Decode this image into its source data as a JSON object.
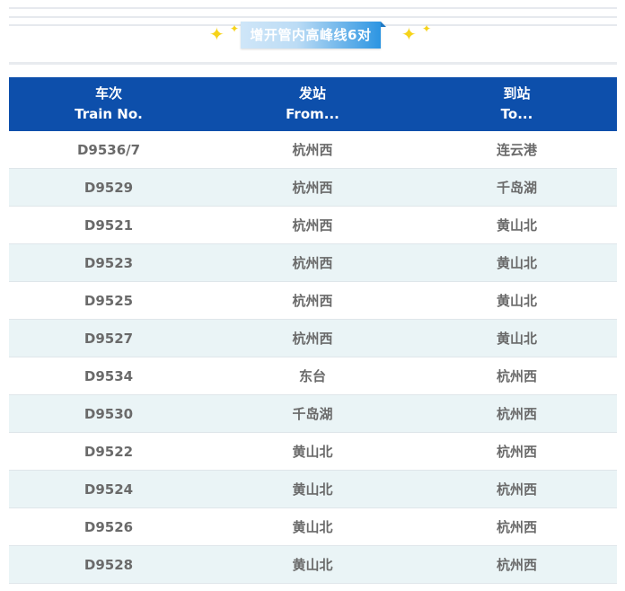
{
  "banner": {
    "title": "增开管内高峰线6对",
    "sparkle_color": "#f6d31a",
    "accent_color": "#2c95e2"
  },
  "table": {
    "header_color": "#0d4fab",
    "stripe_color": "#eaf4f6",
    "headers": [
      {
        "cn": "车次",
        "en": "Train No."
      },
      {
        "cn": "发站",
        "en": "From..."
      },
      {
        "cn": "到站",
        "en": "To..."
      }
    ],
    "rows": [
      {
        "train": "D9536/7",
        "from": "杭州西",
        "to": "连云港"
      },
      {
        "train": "D9529",
        "from": "杭州西",
        "to": "千岛湖"
      },
      {
        "train": "D9521",
        "from": "杭州西",
        "to": "黄山北"
      },
      {
        "train": "D9523",
        "from": "杭州西",
        "to": "黄山北"
      },
      {
        "train": "D9525",
        "from": "杭州西",
        "to": "黄山北"
      },
      {
        "train": "D9527",
        "from": "杭州西",
        "to": "黄山北"
      },
      {
        "train": "D9534",
        "from": "东台",
        "to": "杭州西"
      },
      {
        "train": "D9530",
        "from": "千岛湖",
        "to": "杭州西"
      },
      {
        "train": "D9522",
        "from": "黄山北",
        "to": "杭州西"
      },
      {
        "train": "D9524",
        "from": "黄山北",
        "to": "杭州西"
      },
      {
        "train": "D9526",
        "from": "黄山北",
        "to": "杭州西"
      },
      {
        "train": "D9528",
        "from": "黄山北",
        "to": "杭州西"
      }
    ]
  }
}
